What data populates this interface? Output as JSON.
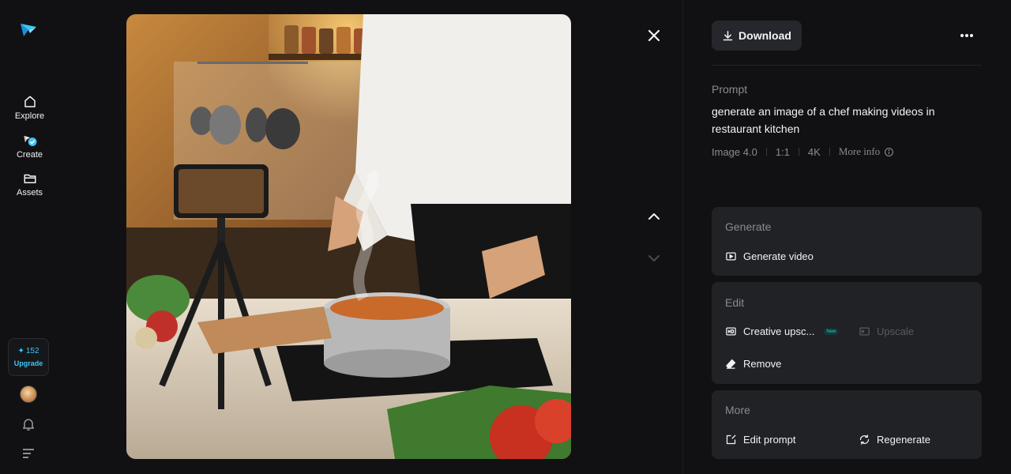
{
  "nav": {
    "items": [
      {
        "label": "Explore",
        "icon": "home-icon"
      },
      {
        "label": "Create",
        "icon": "create-icon"
      },
      {
        "label": "Assets",
        "icon": "folder-icon"
      }
    ],
    "credits": {
      "count": "152",
      "upgrade_label": "Upgrade"
    }
  },
  "toolbar": {
    "download_label": "Download"
  },
  "prompt": {
    "label": "Prompt",
    "text": "generate an image of a chef making videos in restaurant kitchen",
    "model": "Image 4.0",
    "ratio": "1:1",
    "resolution": "4K",
    "more_info_label": "More info"
  },
  "cards": {
    "generate": {
      "title": "Generate",
      "video_label": "Generate video"
    },
    "edit": {
      "title": "Edit",
      "creative_upscale_label": "Creative upsc...",
      "new_badge": "New",
      "upscale_label": "Upscale",
      "remove_label": "Remove"
    },
    "more": {
      "title": "More",
      "edit_prompt_label": "Edit prompt",
      "regenerate_label": "Regenerate"
    }
  },
  "colors": {
    "accent": "#3ec6f5",
    "background": "#111113",
    "card": "#212226"
  }
}
